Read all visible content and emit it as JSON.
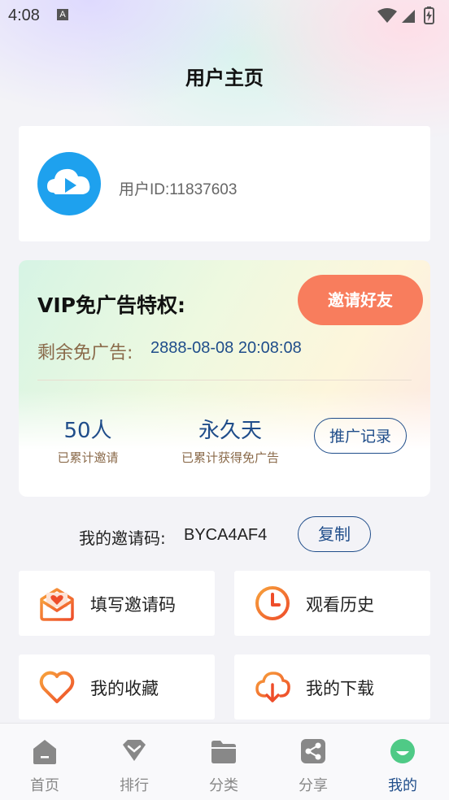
{
  "status_bar": {
    "time": "4:08",
    "notification_letter": "A"
  },
  "page": {
    "title": "用户主页"
  },
  "user": {
    "id_text": "用户ID:11837603"
  },
  "vip": {
    "title": "VIP免广告特权:",
    "invite_button": "邀请好友",
    "remaining_label": "剩余免广告:",
    "remaining_value": "2888-08-08 20:08:08",
    "stats": [
      {
        "value": "50人",
        "label": "已累计邀请"
      },
      {
        "value": "永久天",
        "label": "已累计获得免广告"
      }
    ],
    "record_button": "推广记录"
  },
  "invite_code": {
    "label": "我的邀请码:",
    "value": "BYCA4AF4",
    "copy_button": "复制"
  },
  "tiles": [
    {
      "label": "填写邀请码",
      "icon": "envelope-heart-icon"
    },
    {
      "label": "观看历史",
      "icon": "clock-icon"
    },
    {
      "label": "我的收藏",
      "icon": "heart-icon"
    },
    {
      "label": "我的下载",
      "icon": "cloud-download-icon"
    }
  ],
  "tabbar": {
    "items": [
      {
        "label": "首页",
        "icon": "home-icon"
      },
      {
        "label": "排行",
        "icon": "diamond-icon"
      },
      {
        "label": "分类",
        "icon": "folder-icon"
      },
      {
        "label": "分享",
        "icon": "share-icon"
      },
      {
        "label": "我的",
        "icon": "profile-icon"
      }
    ],
    "active_index": 4
  },
  "colors": {
    "accent": "#1f4d8a",
    "invite_button": "#f87d5d",
    "icon_orange": "#f26a2e"
  }
}
